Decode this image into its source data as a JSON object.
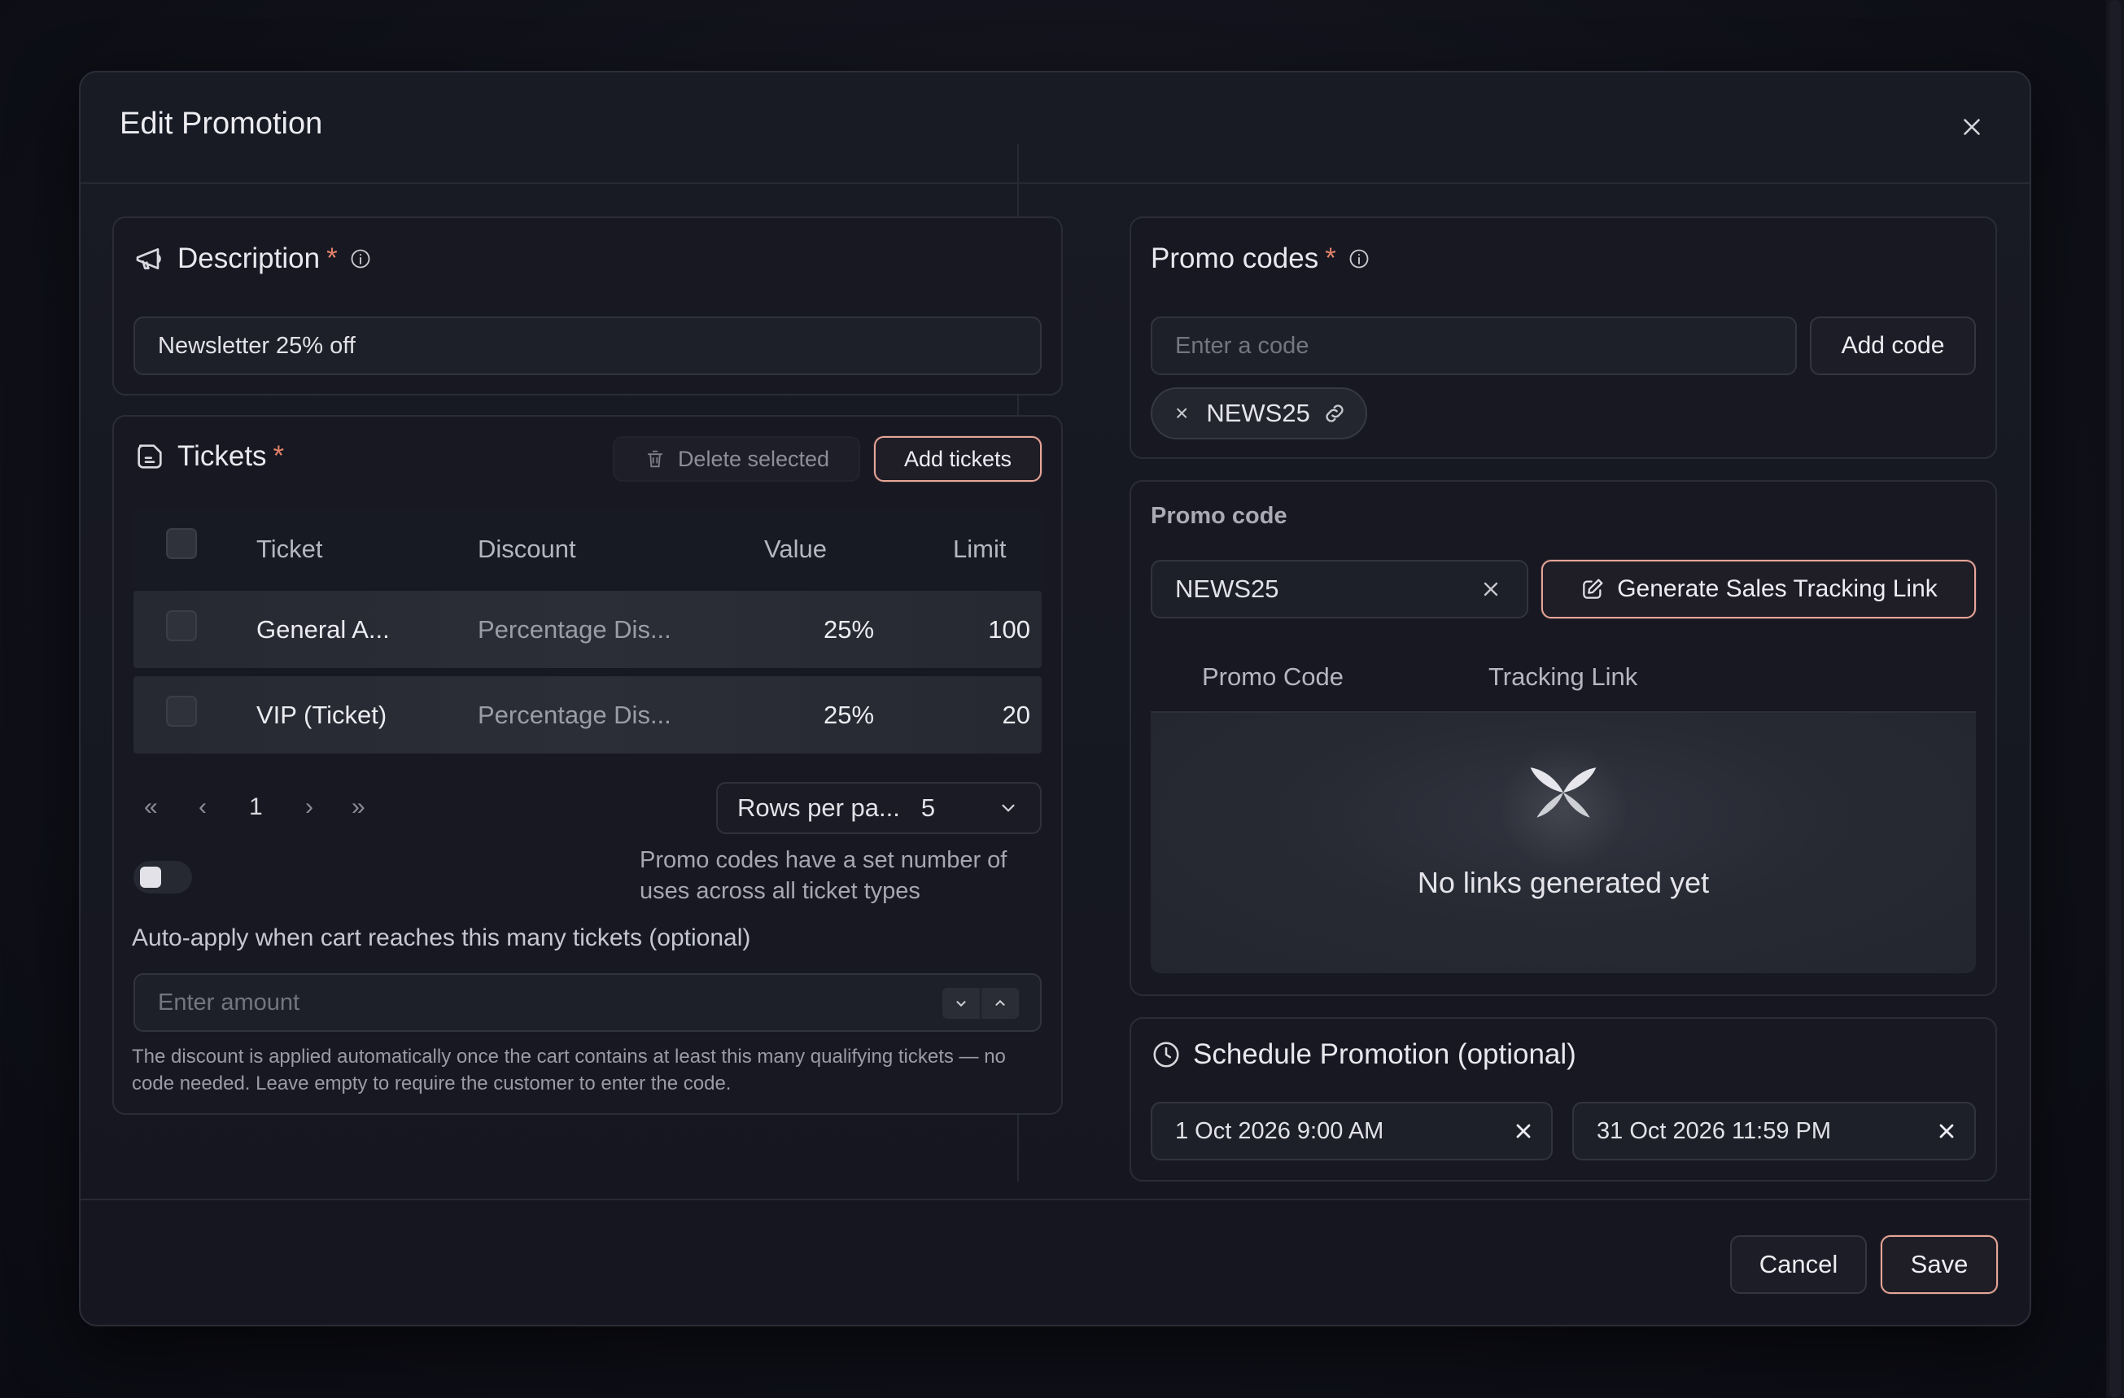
{
  "dialog": {
    "title": "Edit Promotion"
  },
  "description": {
    "title": "Description",
    "required_mark": "*",
    "value": "Newsletter 25% off"
  },
  "tickets": {
    "title": "Tickets",
    "required_mark": "*",
    "delete_selected_label": "Delete selected",
    "add_tickets_label": "Add tickets",
    "columns": [
      "Ticket",
      "Discount",
      "Value",
      "Limit"
    ],
    "rows": [
      {
        "ticket": "General A...",
        "discount": "Percentage Dis...",
        "value": "25%",
        "limit": "100"
      },
      {
        "ticket": "VIP (Ticket)",
        "discount": "Percentage Dis...",
        "value": "25%",
        "limit": "20"
      }
    ],
    "pagination": {
      "first": "«",
      "prev": "‹",
      "page": "1",
      "next": "›",
      "last": "»",
      "rows_per_page_label": "Rows per pa...",
      "rows_per_page_value": "5"
    },
    "toggle_note": "Promo codes have a set number of uses across all ticket types",
    "toggle_on": false
  },
  "auto_apply": {
    "label": "Auto-apply when cart reaches this many tickets (optional)",
    "placeholder": "Enter amount",
    "help": "The discount is applied automatically once the cart contains at least this many qualifying tickets — no code needed. Leave empty to require the customer to enter the code."
  },
  "promo_codes": {
    "title": "Promo codes",
    "required_mark": "*",
    "input_placeholder": "Enter a code",
    "add_code_label": "Add code",
    "chip_remove": "×",
    "codes": [
      "NEWS25"
    ]
  },
  "promo_code": {
    "label": "Promo code",
    "selected_value": "NEWS25",
    "generate_label": "Generate Sales Tracking Link",
    "tabs": [
      "Promo Code",
      "Tracking Link"
    ],
    "empty_text": "No links generated yet"
  },
  "schedule": {
    "title": "Schedule Promotion (optional)",
    "start": "1 Oct 2026 9:00 AM",
    "end": "31 Oct 2026 11:59 PM"
  },
  "footer": {
    "cancel_label": "Cancel",
    "save_label": "Save"
  },
  "colors": {
    "accent_border": "#e7a598",
    "required": "#e0806a",
    "background": "#101119",
    "dialog": "#171822"
  }
}
